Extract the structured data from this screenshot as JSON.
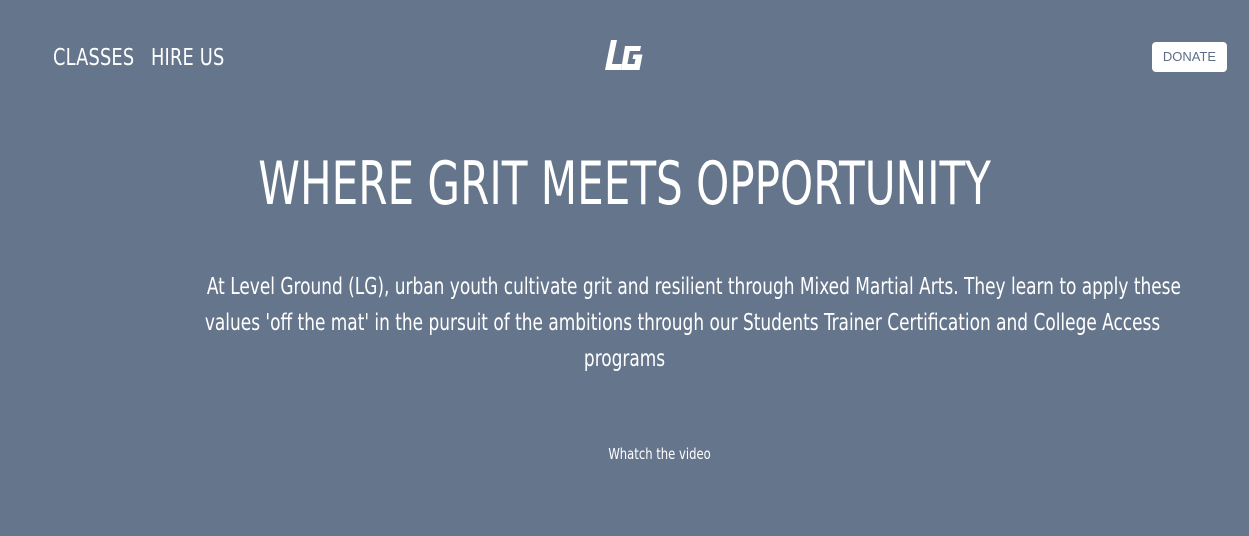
{
  "nav": {
    "classes_label": "CLASSES",
    "hire_label": "HIRE US",
    "donate_label": "DONATE"
  },
  "logo": {
    "text": "LG",
    "icon": "lg-logo-icon"
  },
  "hero": {
    "headline": "WHERE GRIT MEETS OPPORTUNITY",
    "description_lines": [
      "At Level Ground (LG), urban youth cultivate grit and resilient through Mixed Martial Arts. They learn to apply these",
      "values 'off the mat' in the pursuit of the ambitions through our Students Trainer Certification and College Access",
      "programs"
    ],
    "video_label": "Whatch the video"
  },
  "colors": {
    "background": "#65758c",
    "text": "#ffffff",
    "button_background": "#ffffff",
    "button_text": "#5f6e84"
  }
}
